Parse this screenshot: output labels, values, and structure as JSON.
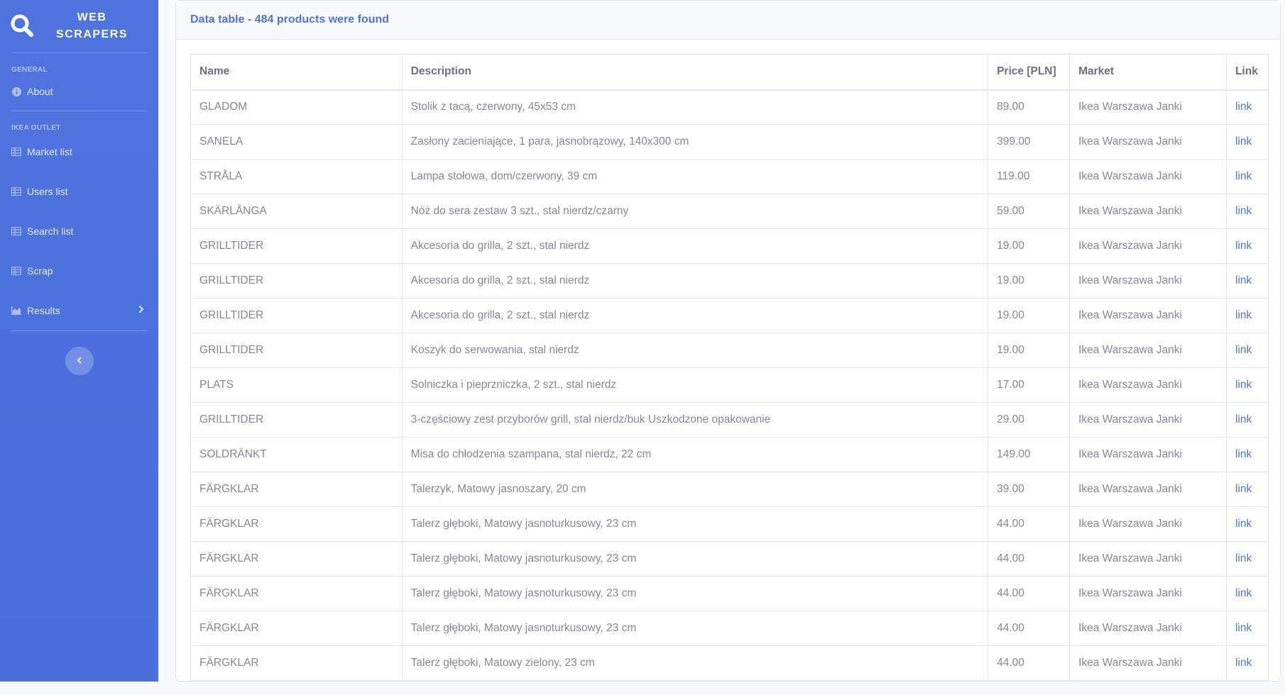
{
  "brand": {
    "line1": "WEB",
    "line2": "SCRAPERS"
  },
  "sidebar": {
    "general_heading": "GENERAL",
    "about_label": "About",
    "ikea_heading": "IKEA OUTLET",
    "items": [
      {
        "label": "Market list",
        "icon": "table-icon"
      },
      {
        "label": "Users list",
        "icon": "table-icon"
      },
      {
        "label": "Search list",
        "icon": "table-icon"
      },
      {
        "label": "Scrap",
        "icon": "table-icon"
      },
      {
        "label": "Results",
        "icon": "chart-area-icon"
      }
    ],
    "toggle_icon": "chevron-left-icon"
  },
  "card": {
    "title": "Data table - 484 products were found"
  },
  "table": {
    "headers": [
      "Name",
      "Description",
      "Price [PLN]",
      "Market",
      "Link"
    ],
    "rows": [
      [
        "GLADOM",
        "Stolik z tacą, czerwony, 45x53 cm",
        "89.00",
        "Ikea Warszawa Janki",
        "link"
      ],
      [
        "SANELA",
        "Zasłony zacieniające, 1 para, jasnobrązowy, 140x300 cm",
        "399.00",
        "Ikea Warszawa Janki",
        "link"
      ],
      [
        "STRÅLA",
        "Lampa stołowa, dom/czerwony, 39 cm",
        "119.00",
        "Ikea Warszawa Janki",
        "link"
      ],
      [
        "SKÄRLÅNGA",
        "Nóż do sera zestaw 3 szt., stal nierdz/czarny",
        "59.00",
        "Ikea Warszawa Janki",
        "link"
      ],
      [
        "GRILLTIDER",
        "Akcesoria do grilla, 2 szt., stal nierdz",
        "19.00",
        "Ikea Warszawa Janki",
        "link"
      ],
      [
        "GRILLTIDER",
        "Akcesoria do grilla, 2 szt., stal nierdz",
        "19.00",
        "Ikea Warszawa Janki",
        "link"
      ],
      [
        "GRILLTIDER",
        "Akcesoria do grilla, 2 szt., stal nierdz",
        "19.00",
        "Ikea Warszawa Janki",
        "link"
      ],
      [
        "GRILLTIDER",
        "Koszyk do serwowania, stal nierdz",
        "19.00",
        "Ikea Warszawa Janki",
        "link"
      ],
      [
        "PLATS",
        "Solniczka i pieprzniczka, 2 szt., stal nierdz",
        "17.00",
        "Ikea Warszawa Janki",
        "link"
      ],
      [
        "GRILLTIDER",
        "3-częściowy zest przyborów grill, stal nierdz/buk Uszkodzone opakowanie",
        "29.00",
        "Ikea Warszawa Janki",
        "link"
      ],
      [
        "SOLDRÄNKT",
        "Misa do chłodzenia szampana, stal nierdz, 22 cm",
        "149.00",
        "Ikea Warszawa Janki",
        "link"
      ],
      [
        "FÄRGKLAR",
        "Talerzyk, Matowy jasnoszary, 20 cm",
        "39.00",
        "Ikea Warszawa Janki",
        "link"
      ],
      [
        "FÄRGKLAR",
        "Talerz głęboki, Matowy jasnoturkusowy, 23 cm",
        "44.00",
        "Ikea Warszawa Janki",
        "link"
      ],
      [
        "FÄRGKLAR",
        "Talerz głęboki, Matowy jasnoturkusowy, 23 cm",
        "44.00",
        "Ikea Warszawa Janki",
        "link"
      ],
      [
        "FÄRGKLAR",
        "Talerz głęboki, Matowy jasnoturkusowy, 23 cm",
        "44.00",
        "Ikea Warszawa Janki",
        "link"
      ],
      [
        "FÄRGKLAR",
        "Talerz głęboki, Matowy jasnoturkusowy, 23 cm",
        "44.00",
        "Ikea Warszawa Janki",
        "link"
      ],
      [
        "FÄRGKLAR",
        "Talerz głęboki, Matowy zielony, 23 cm",
        "44.00",
        "Ikea Warszawa Janki",
        "link"
      ]
    ]
  },
  "colors": {
    "sidebar_bg": "#4e73df",
    "accent": "#4e73df",
    "text": "#858796",
    "border": "#e3e6f0"
  }
}
